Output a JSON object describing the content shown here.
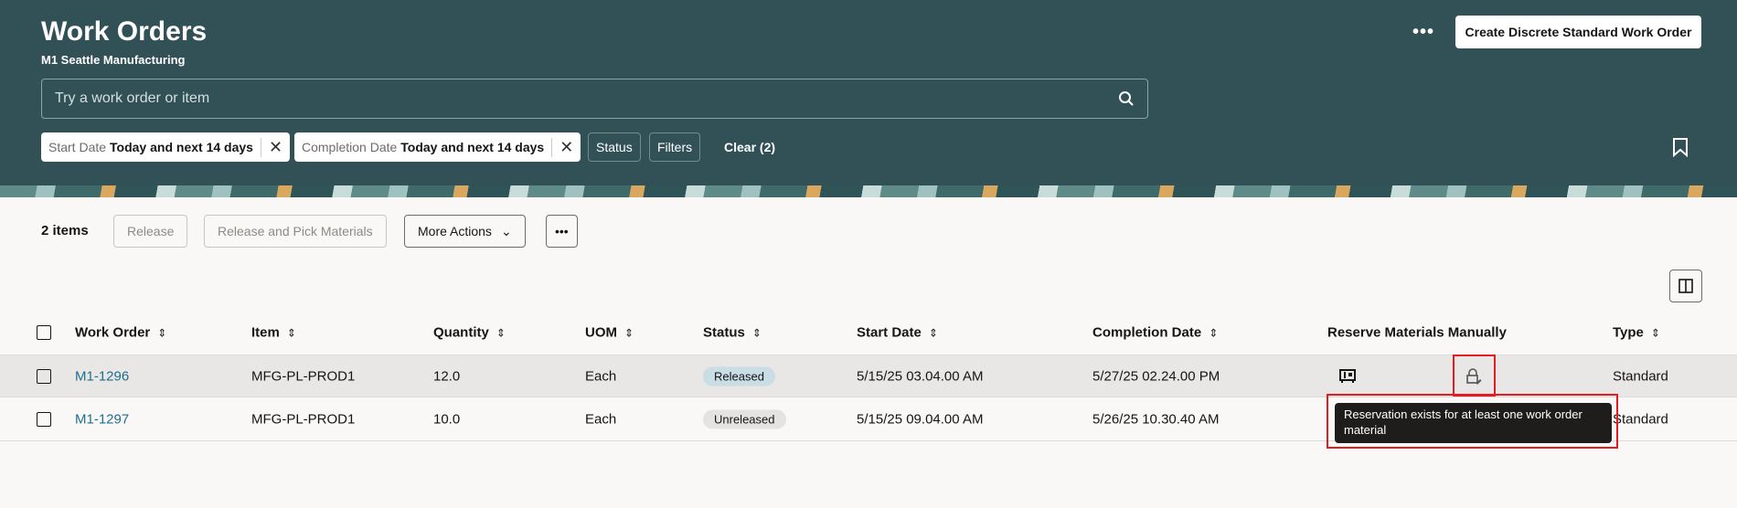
{
  "header": {
    "title": "Work Orders",
    "subtitle": "M1 Seattle Manufacturing",
    "search_placeholder": "Try a work order or item",
    "more": "•••",
    "create_label": "Create Discrete Standard Work Order"
  },
  "filters": [
    {
      "label": "Start Date",
      "value": "Today and next 14 days"
    },
    {
      "label": "Completion Date",
      "value": "Today and next 14 days"
    }
  ],
  "filter_buttons": {
    "status": "Status",
    "filters": "Filters",
    "clear": "Clear (2)"
  },
  "toolbar": {
    "count": "2 items",
    "release": "Release",
    "release_pick": "Release and Pick Materials",
    "more_actions": "More Actions",
    "overflow": "•••"
  },
  "columns": [
    "Work Order",
    "Item",
    "Quantity",
    "UOM",
    "Status",
    "Start Date",
    "Completion Date",
    "Reserve Materials Manually",
    "Type"
  ],
  "rows": [
    {
      "work_order": "M1-1296",
      "item": "MFG-PL-PROD1",
      "quantity": "12.0",
      "uom": "Each",
      "status": "Released",
      "start": "5/15/25 03.04.00 AM",
      "completion": "5/27/25 02.24.00 PM",
      "type": "Standard"
    },
    {
      "work_order": "M1-1297",
      "item": "MFG-PL-PROD1",
      "quantity": "10.0",
      "uom": "Each",
      "status": "Unreleased",
      "start": "5/15/25 09.04.00 AM",
      "completion": "5/26/25 10.30.40 AM",
      "type": "Standard"
    }
  ],
  "tooltip": "Reservation exists for at least one work order material"
}
